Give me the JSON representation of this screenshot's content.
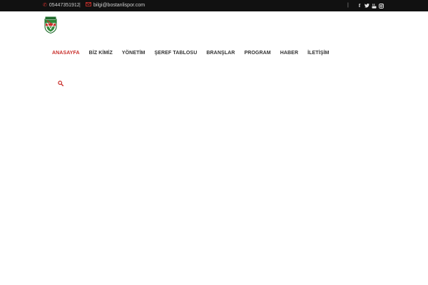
{
  "topbar": {
    "phone": "05447351912",
    "separator": "|",
    "email": "bilgi@bostanlispor.com",
    "icons": [
      "phone-icon",
      "mail-icon"
    ],
    "social": [
      "facebook-icon",
      "twitter-icon",
      "youtube-icon",
      "instagram-icon"
    ]
  },
  "logo": {
    "icon": "club-crest-logo"
  },
  "nav": {
    "items": [
      {
        "label": "ANASAYFA",
        "active": true
      },
      {
        "label": "BİZ KİMİZ",
        "active": false
      },
      {
        "label": "YÖNETİM",
        "active": false
      },
      {
        "label": "ŞEREF TABLOSU",
        "active": false
      },
      {
        "label": "BRANŞLAR",
        "active": false
      },
      {
        "label": "PROGRAM",
        "active": false
      },
      {
        "label": "HABER",
        "active": false
      },
      {
        "label": "İLETİŞİM",
        "active": false
      }
    ]
  },
  "search": {
    "icon": "search-icon"
  },
  "colors": {
    "accent": "#c9302c",
    "topbar_bg": "#111111",
    "nav_text": "#333333"
  }
}
